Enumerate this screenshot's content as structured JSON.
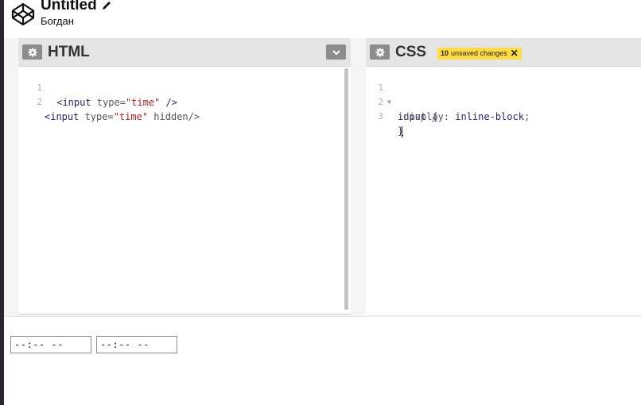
{
  "header": {
    "title": "Untitled",
    "author": "Богдан"
  },
  "html_pane": {
    "title": "HTML",
    "lines": [
      {
        "num": "1",
        "tag_open": " <input",
        "attr": " type=",
        "str": "\"time\"",
        "rest": " />"
      },
      {
        "num": "2",
        "tag_open": "<input",
        "attr": " type=",
        "str": "\"time\"",
        "rest": " hidden/>"
      }
    ]
  },
  "css_pane": {
    "title": "CSS",
    "badge": {
      "count": "10",
      "text": "unsaved changes"
    },
    "lines": [
      {
        "num": "1",
        "selector": "input",
        "brace": "{"
      },
      {
        "num": "2",
        "prop": " display",
        "colon": ": ",
        "value": "inline-block",
        "semi": ";"
      },
      {
        "num": "3",
        "brace": "}"
      }
    ]
  },
  "preview": {
    "inputs": [
      {
        "value": "--:-- --"
      },
      {
        "value": "--:-- --"
      }
    ]
  },
  "colors": {
    "badge": "#ffdd40",
    "pane_header": "#e4e4e4",
    "button": "#8c8c8c",
    "tag": "#262673",
    "string": "#b32424"
  }
}
